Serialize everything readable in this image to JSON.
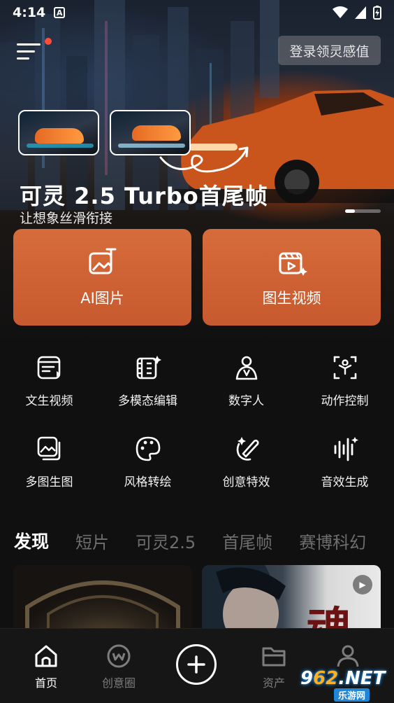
{
  "status_bar": {
    "time": "4:14",
    "notif_icon": "A"
  },
  "header": {
    "login_label": "登录领灵感值"
  },
  "banner": {
    "title": "可灵 2.5 Turbo首尾帧",
    "subtitle": "让想象丝滑衔接"
  },
  "primary_actions": [
    {
      "label": "AI图片",
      "icon": "ai-image-icon"
    },
    {
      "label": "图生视频",
      "icon": "image-to-video-icon"
    }
  ],
  "tools": [
    {
      "label": "文生视频",
      "icon": "text-to-video-icon"
    },
    {
      "label": "多模态编辑",
      "icon": "multimodal-edit-icon"
    },
    {
      "label": "数字人",
      "icon": "digital-human-icon"
    },
    {
      "label": "动作控制",
      "icon": "motion-control-icon"
    },
    {
      "label": "多图生图",
      "icon": "multi-image-icon"
    },
    {
      "label": "风格转绘",
      "icon": "style-transfer-icon"
    },
    {
      "label": "创意特效",
      "icon": "creative-effects-icon"
    },
    {
      "label": "音效生成",
      "icon": "sound-effects-icon"
    }
  ],
  "feed_tabs": [
    "发现",
    "短片",
    "可灵2.5",
    "首尾帧",
    "赛博科幻"
  ],
  "feed_cards": {
    "right_overlay_text": "魂"
  },
  "bottom_nav": {
    "home": "首页",
    "creative": "创意圈",
    "assets": "资产"
  },
  "watermark": {
    "main_left": "9",
    "main_mid": "62",
    "main_right": ".NET",
    "sub": "乐游网"
  },
  "colors": {
    "accent": "#d0653a",
    "notification_dot": "#ff4d3a",
    "background": "#101010"
  }
}
